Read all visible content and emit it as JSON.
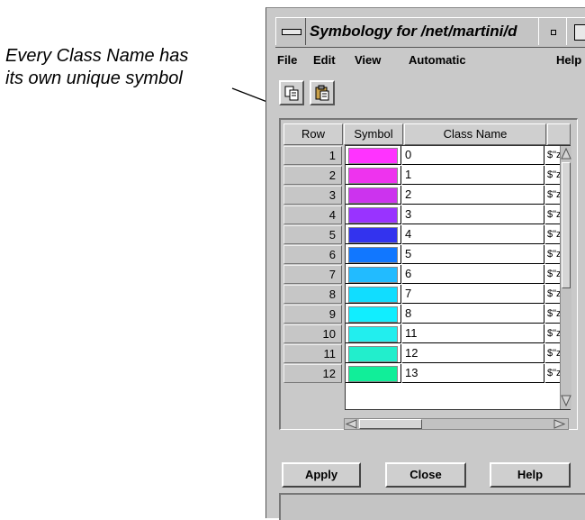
{
  "annotation": {
    "line1": "Every Class Name has",
    "line2": "its own unique symbol"
  },
  "window": {
    "title": "Symbology for /net/martini/d",
    "menu": [
      "File",
      "Edit",
      "View",
      "Automatic",
      "Help"
    ]
  },
  "toolbar": {
    "copy_icon": "copy-icon",
    "paste_icon": "paste-icon"
  },
  "table": {
    "headers": {
      "row": "Row",
      "symbol": "Symbol",
      "class_name": "Class Name"
    },
    "rows": [
      {
        "row": "1",
        "color": "#ff33ff",
        "name": "0",
        "expr": "$\"z"
      },
      {
        "row": "2",
        "color": "#ee33ee",
        "name": "1",
        "expr": "$\"z"
      },
      {
        "row": "3",
        "color": "#cc33ee",
        "name": "2",
        "expr": "$\"z"
      },
      {
        "row": "4",
        "color": "#9933ff",
        "name": "3",
        "expr": "$\"z"
      },
      {
        "row": "5",
        "color": "#3333ee",
        "name": "4",
        "expr": "$\"z"
      },
      {
        "row": "6",
        "color": "#1177ff",
        "name": "5",
        "expr": "$\"z"
      },
      {
        "row": "7",
        "color": "#22bbff",
        "name": "6",
        "expr": "$\"z"
      },
      {
        "row": "8",
        "color": "#11ddff",
        "name": "7",
        "expr": "$\"z"
      },
      {
        "row": "9",
        "color": "#11eeff",
        "name": "8",
        "expr": "$\"z"
      },
      {
        "row": "10",
        "color": "#22eeee",
        "name": "11",
        "expr": "$\"z"
      },
      {
        "row": "11",
        "color": "#22eecc",
        "name": "12",
        "expr": "$\"z"
      },
      {
        "row": "12",
        "color": "#11ee99",
        "name": "13",
        "expr": "$\"z"
      }
    ]
  },
  "buttons": {
    "apply": "Apply",
    "close": "Close",
    "help": "Help"
  }
}
